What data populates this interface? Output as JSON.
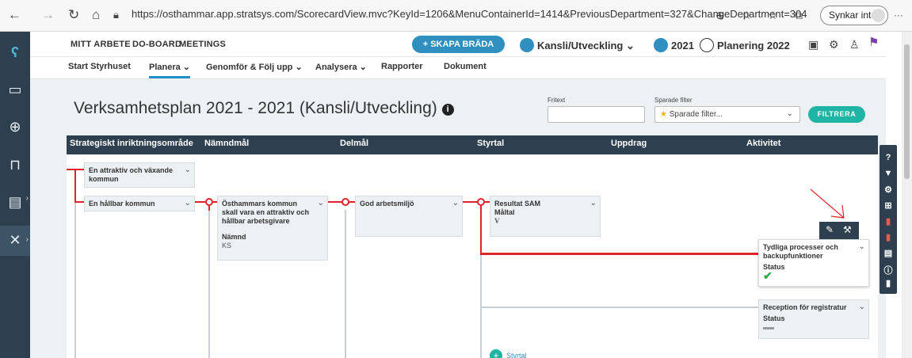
{
  "browser": {
    "url": "https://osthammar.app.stratsys.com/ScorecardView.mvc?KeyId=1206&MenuContainerId=1414&PreviousDepartment=327&ChangeDepartment=304",
    "sync_label": "Synkar inte",
    "more": "···"
  },
  "topnav": {
    "items": [
      "MITT ARBETE",
      "DO-BOARD",
      "MEETINGS"
    ],
    "create_button": "+ SKAPA BRÄDA",
    "department": "Kansli/Utveckling",
    "year": "2021",
    "plan": "Planering 2022"
  },
  "subnav": {
    "items": [
      "Start Styrhuset",
      "Planera",
      "Genomför & Följ upp",
      "Analysera",
      "Rapporter",
      "Dokument"
    ],
    "active_index": 1
  },
  "page": {
    "title": "Verksamhetsplan 2021 - 2021 (Kansli/Utveckling)",
    "info": "i"
  },
  "filter": {
    "fritext_label": "Fritext",
    "fritext_value": "",
    "saved_label": "Sparade filter",
    "saved_placeholder": "Sparade filter...",
    "button": "FILTRERA"
  },
  "columns": [
    "Strategiskt inriktningsområde",
    "Nämndmål",
    "Delmål",
    "Styrtal",
    "Uppdrag",
    "Aktivitet"
  ],
  "cards": {
    "area1": "En attraktiv och växande kommun",
    "area2": "En hållbar kommun",
    "namndmal": {
      "title": "Östhammars kommun skall vara en attraktiv och hållbar arbetsgivare",
      "sub_label": "Nämnd",
      "sub_value": "KS"
    },
    "delmal": "God arbetsmiljö",
    "styrtal": {
      "title": "Resultat SAM",
      "sub_label": "Måltal",
      "sub_value": "V"
    },
    "aktivitet1": {
      "title": "Tydliga processer och backupfunktioner",
      "sub_label": "Status"
    },
    "aktivitet2": {
      "title": "Reception för registratur",
      "sub_label": "Status"
    }
  },
  "add_styrtal": "Styrtal",
  "colors": {
    "accent": "#2f8fbf",
    "teal": "#1fb5a5",
    "dark": "#2e4050",
    "red": "#e0242b",
    "green": "#2aa84a"
  }
}
